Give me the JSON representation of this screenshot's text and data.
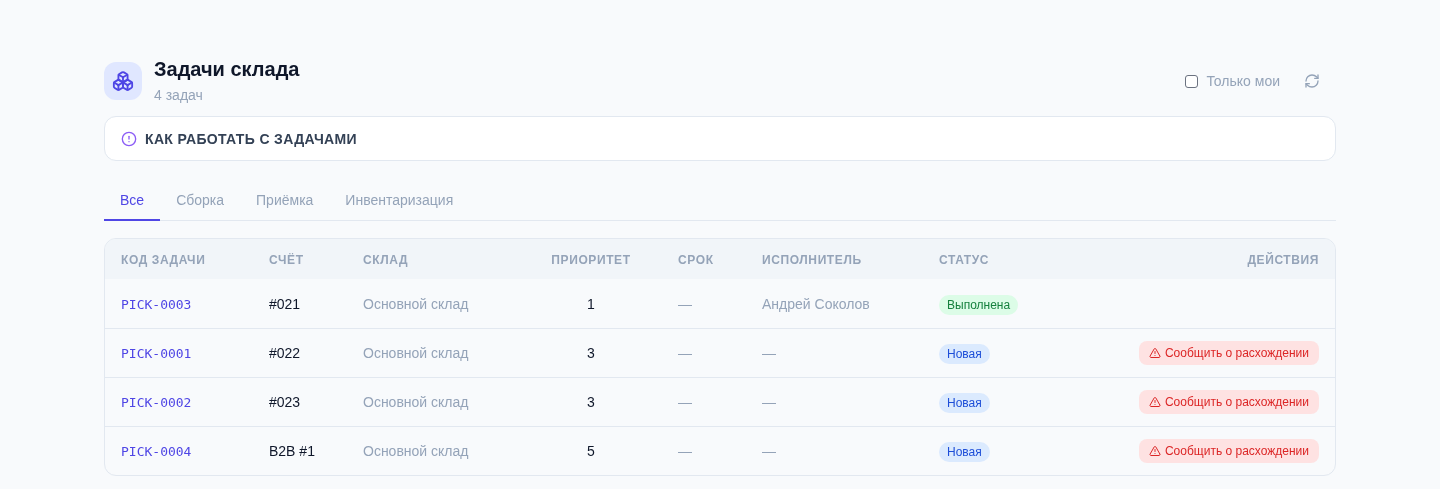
{
  "header": {
    "title": "Задачи склада",
    "subtitle": "4 задач",
    "only_mine": {
      "label": "Только мои",
      "checked": false
    }
  },
  "callout": {
    "text": "КАК РАБОТАТЬ С ЗАДАЧАМИ"
  },
  "tabs": [
    {
      "label": "Все",
      "selected": true
    },
    {
      "label": "Сборка",
      "selected": false
    },
    {
      "label": "Приёмка",
      "selected": false
    },
    {
      "label": "Инвентаризация",
      "selected": false
    }
  ],
  "table": {
    "columns": [
      "КОД ЗАДАЧИ",
      "СЧЁТ",
      "СКЛАД",
      "ПРИОРИТЕТ",
      "СРОК",
      "ИСПОЛНИТЕЛЬ",
      "СТАТУС",
      "ДЕЙСТВИЯ"
    ],
    "rows": [
      {
        "code": "PICK-0003",
        "invoice": "#021",
        "warehouse": "Основной склад",
        "priority": "1",
        "due": "—",
        "assignee": "Андрей Соколов",
        "status": {
          "kind": "done",
          "label": "Выполнена"
        }
      },
      {
        "code": "PICK-0001",
        "invoice": "#022",
        "warehouse": "Основной склад",
        "priority": "3",
        "due": "—",
        "assignee": "—",
        "status": {
          "kind": "new",
          "label": "Новая"
        },
        "action": "Сообщить о расхождении"
      },
      {
        "code": "PICK-0002",
        "invoice": "#023",
        "warehouse": "Основной склад",
        "priority": "3",
        "due": "—",
        "assignee": "—",
        "status": {
          "kind": "new",
          "label": "Новая"
        },
        "action": "Сообщить о расхождении"
      },
      {
        "code": "PICK-0004",
        "invoice": "B2B #1",
        "warehouse": "Основной склад",
        "priority": "5",
        "due": "—",
        "assignee": "—",
        "status": {
          "kind": "new",
          "label": "Новая"
        },
        "action": "Сообщить о расхождении"
      }
    ]
  }
}
